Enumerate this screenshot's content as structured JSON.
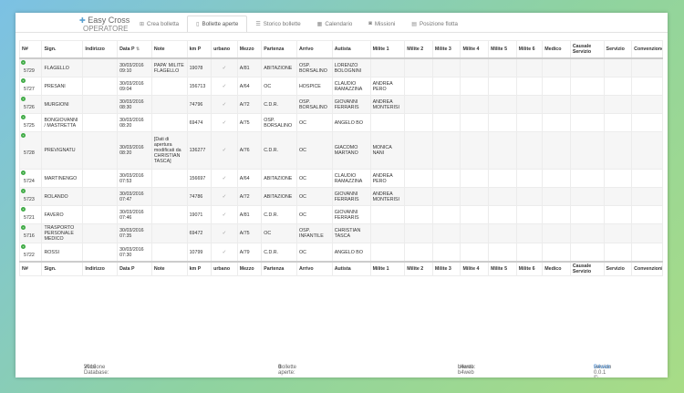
{
  "brand": {
    "title": "Easy Cross",
    "subtitle": "OPERATORE"
  },
  "tabs": [
    {
      "label": "Crea bolletta",
      "icon": "plus-square-icon",
      "active": false
    },
    {
      "label": "Bollette aperte",
      "icon": "file-icon",
      "active": true
    },
    {
      "label": "Storico bollette",
      "icon": "list-icon",
      "active": false
    },
    {
      "label": "Calendario",
      "icon": "calendar-icon",
      "active": false
    },
    {
      "label": "Missioni",
      "icon": "camera-icon",
      "active": false
    },
    {
      "label": "Posizione flotta",
      "icon": "map-icon",
      "active": false
    }
  ],
  "table": {
    "headers": [
      "N#",
      "Sign.",
      "Indirizzo",
      "Data P",
      "Note",
      "km P",
      "urbano",
      "Mezzo",
      "Partenza",
      "Arrivo",
      "Autista",
      "Milite 1",
      "Milite 2",
      "Milite 3",
      "Milite 4",
      "Milite 5",
      "Milite 6",
      "Medico",
      "Causale Servizio",
      "Servizio",
      "Convenzione"
    ],
    "footer": [
      "N#",
      "Sign.",
      "Indirizzo",
      "Data P",
      "Note",
      "km P",
      "urbano",
      "Mezzo",
      "Partenza",
      "Arrivo",
      "Autista",
      "Milite 1",
      "Milite 2",
      "Milite 3",
      "Milite 4",
      "Milite 5",
      "Milite 6",
      "Medico",
      "Causale Servizio",
      "Servizio",
      "Convenzioni"
    ],
    "rows": [
      {
        "n": "5729",
        "sign": "FLAGELLO",
        "data": "30/03/2016 09:10",
        "note": "PAPA' MILITE FLAGELLO",
        "km": "19078",
        "urbano": "✓",
        "mezzo": "A/81",
        "partenza": "ABITAZIONE",
        "arrivo": "OSP. BORSALINO",
        "autista": "LORENZO BOLOGNINI",
        "milite1": ""
      },
      {
        "n": "5727",
        "sign": "PRESANI",
        "data": "30/03/2016 09:04",
        "note": "",
        "km": "156713",
        "urbano": "✓",
        "mezzo": "A/64",
        "partenza": "OC",
        "arrivo": "HOSPICE",
        "autista": "CLAUDIO RAMAZZINA",
        "milite1": "ANDREA PERO"
      },
      {
        "n": "5726",
        "sign": "MURGIONI",
        "data": "30/03/2016 08:30",
        "note": "",
        "km": "74796",
        "urbano": "✓",
        "mezzo": "A/72",
        "partenza": "C.D.R.",
        "arrivo": "OSP. BORSALINO",
        "autista": "GIOVANNI FERRARIS",
        "milite1": "ANDREA MONTERISI"
      },
      {
        "n": "5725",
        "sign": "BONGIOVANNI / MASTRETTA",
        "data": "30/03/2016 08:20",
        "note": "",
        "km": "69474",
        "urbano": "✓",
        "mezzo": "A/75",
        "partenza": "OSP. BORSALINO",
        "arrivo": "OC",
        "autista": "ANGELO BO",
        "milite1": ""
      },
      {
        "n": "5728",
        "sign": "PREVIGNATU",
        "data": "30/03/2016 08:20",
        "note": "[Dati di apertura modificati da CHRISTIAN TASCA]",
        "km": "136277",
        "urbano": "✓",
        "mezzo": "A/76",
        "partenza": "C.D.R.",
        "arrivo": "OC",
        "autista": "GIACOMO MARTANO",
        "milite1": "MONICA NANI"
      },
      {
        "n": "5724",
        "sign": "MARTINENGO",
        "data": "30/03/2016 07:53",
        "note": "",
        "km": "156697",
        "urbano": "✓",
        "mezzo": "A/64",
        "partenza": "ABITAZIONE",
        "arrivo": "OC",
        "autista": "CLAUDIO RAMAZZINA",
        "milite1": "ANDREA PERO"
      },
      {
        "n": "5723",
        "sign": "ROLANDO",
        "data": "30/03/2016 07:47",
        "note": "",
        "km": "74786",
        "urbano": "✓",
        "mezzo": "A/72",
        "partenza": "ABITAZIONE",
        "arrivo": "OC",
        "autista": "GIOVANNI FERRARIS",
        "milite1": "ANDREA MONTERISI"
      },
      {
        "n": "5721",
        "sign": "FAVERO",
        "data": "30/03/2016 07:46",
        "note": "",
        "km": "19071",
        "urbano": "✓",
        "mezzo": "A/81",
        "partenza": "C.D.R.",
        "arrivo": "OC",
        "autista": "GIOVANNI FERRARIS",
        "milite1": ""
      },
      {
        "n": "5716",
        "sign": "TRASPORTO PERSONALE MEDICO",
        "data": "30/03/2016 07:35",
        "note": "",
        "km": "69472",
        "urbano": "✓",
        "mezzo": "A/75",
        "partenza": "OC",
        "arrivo": "OSP. INFANTILE",
        "autista": "CHRISTIAN TASCA",
        "milite1": ""
      },
      {
        "n": "5722",
        "sign": "ROSSI",
        "data": "30/03/2016 07:30",
        "note": "",
        "km": "10799",
        "urbano": "✓",
        "mezzo": "A/79",
        "partenza": "C.D.R.",
        "arrivo": "OC",
        "autista": "ANGELO BO",
        "milite1": ""
      }
    ]
  },
  "footer": {
    "db_label": "Versione Database:",
    "db_value": "2016",
    "open_label": "Bollette aperte:",
    "open_value": "0",
    "user_label": "Utente:",
    "user_value": "b4web b4web",
    "version_text": "version 0.0.1 © 2017",
    "version_link": "B4web"
  }
}
